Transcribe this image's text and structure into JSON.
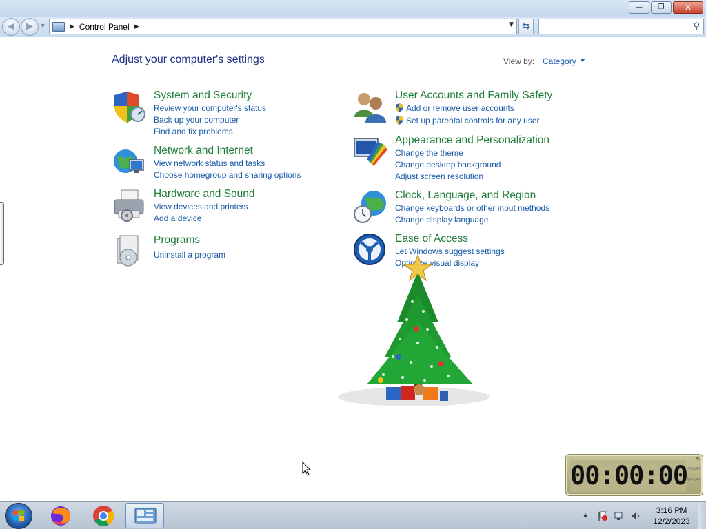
{
  "window": {
    "buttons": {
      "minimize": "—",
      "maximize": "❐",
      "close": "✕"
    }
  },
  "navbar": {
    "back_glyph": "◀",
    "forward_glyph": "▶",
    "breadcrumb": [
      "Control Panel"
    ],
    "search_placeholder": ""
  },
  "content": {
    "heading": "Adjust your computer's settings",
    "view_by_label": "View by:",
    "view_by_value": "Category",
    "categories": [
      {
        "title": "System and Security",
        "links": [
          "Review your computer's status",
          "Back up your computer",
          "Find and fix problems"
        ]
      },
      {
        "title": "Network and Internet",
        "links": [
          "View network status and tasks",
          "Choose homegroup and sharing options"
        ]
      },
      {
        "title": "Hardware and Sound",
        "links": [
          "View devices and printers",
          "Add a device"
        ]
      },
      {
        "title": "Programs",
        "links": [
          "Uninstall a program"
        ]
      },
      {
        "title": "User Accounts and Family Safety",
        "links": [
          "Add or remove user accounts",
          "Set up parental controls for any user"
        ]
      },
      {
        "title": "Appearance and Personalization",
        "links": [
          "Change the theme",
          "Change desktop background",
          "Adjust screen resolution"
        ]
      },
      {
        "title": "Clock, Language, and Region",
        "links": [
          "Change keyboards or other input methods",
          "Change display language"
        ]
      },
      {
        "title": "Ease of Access",
        "links": [
          "Let Windows suggest settings",
          "Optimize visual display"
        ]
      }
    ]
  },
  "timer_gadget": {
    "display": "00:00:00",
    "start_label": "START",
    "reset_label": "RESET",
    "close": "✕"
  },
  "taskbar": {
    "apps": [
      "start-orb",
      "firefox-icon",
      "chrome-icon",
      "control-panel-icon"
    ],
    "clock_time": "3:16 PM",
    "clock_date": "12/2/2023"
  },
  "colors": {
    "category_title": "#1e7d3a",
    "link": "#1a5ca8",
    "heading": "#1e3287"
  }
}
